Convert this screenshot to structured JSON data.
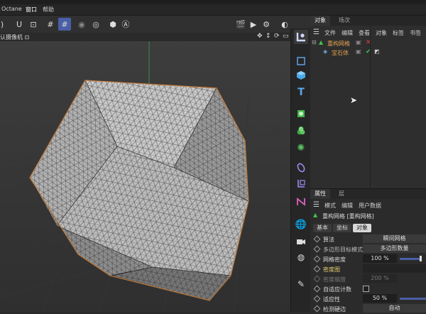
{
  "menubar": {
    "items": [
      "Octane",
      "窗口",
      "帮助"
    ]
  },
  "viewport": {
    "camera_label": "认摄像机 ⊡",
    "nav_icons": [
      "move-icon",
      "rotate-icon",
      "zoom-icon",
      "maximize-icon"
    ]
  },
  "object_manager": {
    "tabs": [
      "对象",
      "场次"
    ],
    "menu": [
      "文件",
      "编辑",
      "查看",
      "对象",
      "标签",
      "书签"
    ],
    "rows": [
      {
        "name": "重构网格",
        "color": "#e0a050",
        "status": "x"
      },
      {
        "name": "宝石体",
        "color": "#e0a050",
        "status": "check"
      }
    ]
  },
  "attributes": {
    "tabs": [
      "属性",
      "层"
    ],
    "menu": [
      "模式",
      "编辑",
      "用户数据"
    ],
    "object_title": "重构网格 [重构网格]",
    "subtabs": [
      "基本",
      "坐标",
      "对象"
    ],
    "fields": [
      {
        "label": "算法",
        "value": "瞬间网格"
      },
      {
        "label": "多边形目标模式",
        "value": "多边形数量"
      },
      {
        "label": "网格密度",
        "value": "100 %"
      },
      {
        "label": "密度图",
        "value": ""
      },
      {
        "label": "密度缩放",
        "value": "200 %"
      },
      {
        "label": "自适应计数",
        "value": ""
      },
      {
        "label": "适应性",
        "value": "50 %"
      },
      {
        "label": "检测硬边",
        "value": "自动"
      }
    ]
  },
  "colors": {
    "accent": "#4b5fa6",
    "highlight_orange": "#e0a050",
    "check_green": "#38c060",
    "x_red": "#e04040"
  }
}
